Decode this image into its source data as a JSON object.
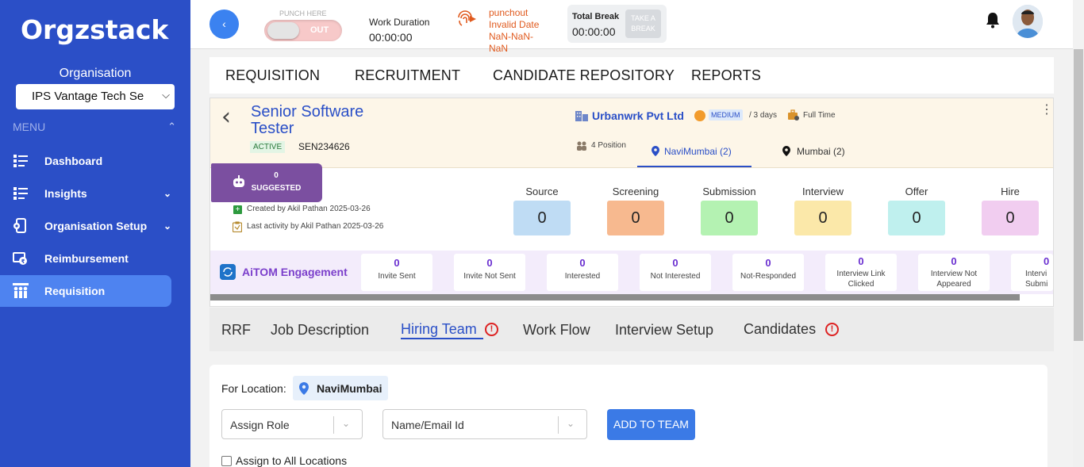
{
  "sidebar": {
    "logo": "Orgzstack",
    "org_label": "Organisation",
    "org_selected": "IPS Vantage Tech Se",
    "menu_header": "MENU",
    "items": [
      {
        "label": "Dashboard",
        "icon": "dashboard-icon"
      },
      {
        "label": "Insights",
        "icon": "insights-icon"
      },
      {
        "label": "Organisation Setup",
        "icon": "organisation-setup-icon"
      },
      {
        "label": "Reimbursement",
        "icon": "reimbursement-icon"
      },
      {
        "label": "Requisition",
        "icon": "requisition-icon",
        "active": true
      }
    ]
  },
  "topbar": {
    "back_glyph": "‹",
    "punch_here": "PUNCH HERE",
    "toggle_label": "OUT",
    "work_duration_label": "Work Duration",
    "work_duration_value": "00:00:00",
    "punchout_lines": [
      "punchout",
      "Invalid Date",
      "NaN-NaN-",
      "NaN"
    ],
    "total_break_label": "Total Break",
    "total_break_value": "00:00:00",
    "take_break": [
      "TAKE A",
      "BREAK"
    ]
  },
  "main_tabs": [
    "REQUISITION",
    "RECRUITMENT",
    "CANDIDATE REPOSITORY",
    "REPORTS"
  ],
  "job": {
    "title_lines": [
      "Senior Software",
      "Tester"
    ],
    "status": "ACTIVE",
    "code": "SEN234626",
    "company": "Urbanwrk Pvt Ltd",
    "priority": "MEDIUM",
    "duration": "/ 3 days",
    "employment_type": "Full Time",
    "positions": "4 Position",
    "locations": [
      {
        "label": "NaviMumbai (2)",
        "active": true
      },
      {
        "label": "Mumbai (2)",
        "active": false
      }
    ],
    "suggested_count": "0",
    "suggested_label": "SUGGESTED",
    "created": "Created by Akil Pathan 2025-03-26",
    "last_activity": "Last activity by Akil Pathan 2025-03-26"
  },
  "pipeline": [
    {
      "label": "Source",
      "value": "0",
      "color": "#bfdcf4"
    },
    {
      "label": "Screening",
      "value": "0",
      "color": "#f7b98f"
    },
    {
      "label": "Submission",
      "value": "0",
      "color": "#b4f2b2"
    },
    {
      "label": "Interview",
      "value": "0",
      "color": "#fbe8a9"
    },
    {
      "label": "Offer",
      "value": "0",
      "color": "#bff0ee"
    },
    {
      "label": "Hire",
      "value": "0",
      "color": "#f1cdf0"
    }
  ],
  "engagement": {
    "title": "AiTOM Engagement",
    "cards": [
      {
        "value": "0",
        "label": "Invite Sent"
      },
      {
        "value": "0",
        "label": "Invite Not Sent"
      },
      {
        "value": "0",
        "label": "Interested"
      },
      {
        "value": "0",
        "label": "Not Interested"
      },
      {
        "value": "0",
        "label": "Not-Responded"
      },
      {
        "value": "0",
        "label": "Interview Link Clicked"
      },
      {
        "value": "0",
        "label": "Interview Not Appeared"
      },
      {
        "value": "0",
        "label": "Intervi Submi"
      }
    ]
  },
  "sub_tabs": [
    "RRF",
    "Job Description",
    "Hiring Team",
    "Work Flow",
    "Interview Setup",
    "Candidates"
  ],
  "form": {
    "for_location_label": "For Location:",
    "location": "NaviMumbai",
    "role_placeholder": "Assign Role",
    "name_placeholder": "Name/Email Id",
    "add_button": "ADD TO TEAM",
    "assign_all_label": "Assign to All Locations"
  }
}
